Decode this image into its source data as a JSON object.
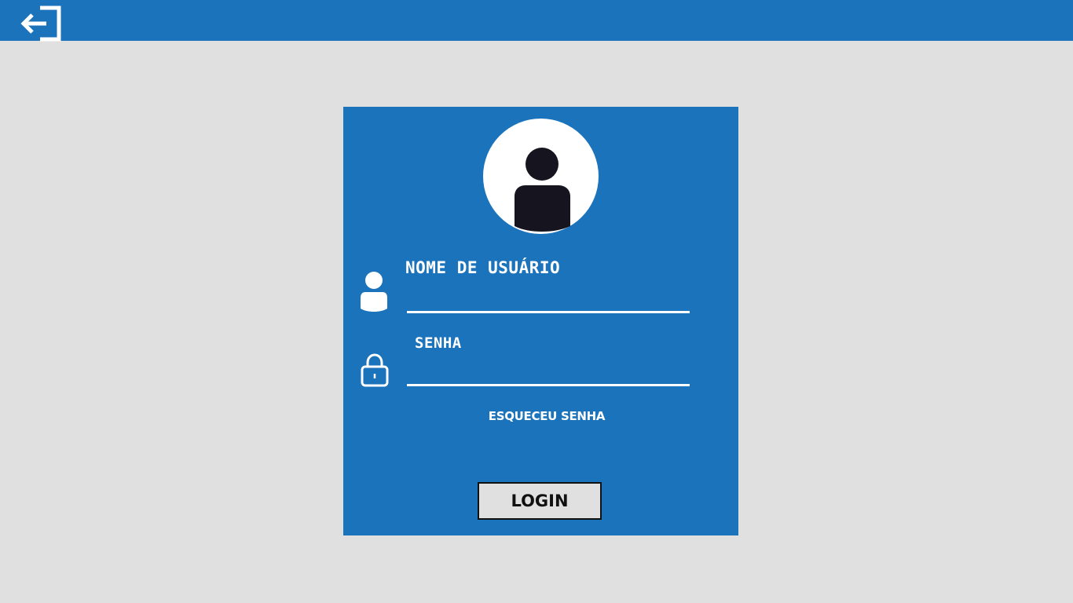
{
  "topbar": {
    "background": "#1a73bb",
    "logout_icon": "logout-icon"
  },
  "login_card": {
    "background": "#1a73bb",
    "avatar_icon": "user-avatar-icon",
    "username": {
      "label": "NOME DE USUÁRIO",
      "icon": "user-icon",
      "value": ""
    },
    "password": {
      "label": "SENHA",
      "icon": "lock-icon",
      "value": ""
    },
    "forgot_password": "ESQUECEU SENHA",
    "login_button": "LOGIN"
  },
  "colors": {
    "page_background": "#e0e0e0",
    "accent": "#1a73bb",
    "avatar_figure": "#16151f",
    "button_background": "#e0e0e0"
  }
}
